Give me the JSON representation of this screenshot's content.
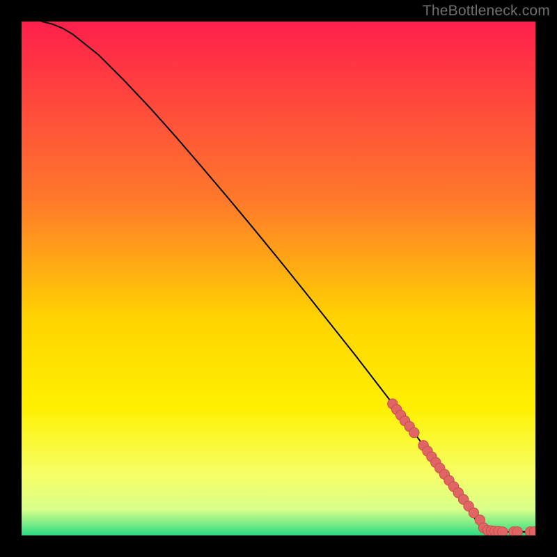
{
  "watermark": "TheBottleneck.com",
  "colors": {
    "black": "#000000",
    "line": "#000000",
    "marker_fill": "#e06666",
    "marker_stroke": "#cc4b4b",
    "gradient_top": "#ff1f4b",
    "gradient_mid1": "#ff7a2a",
    "gradient_mid2": "#ffd400",
    "gradient_mid3": "#fff000",
    "gradient_mid4": "#f7ff66",
    "gradient_mid5": "#d8ff8a",
    "gradient_bottom": "#2bdc82"
  },
  "chart_data": {
    "type": "line",
    "title": "",
    "xlabel": "",
    "ylabel": "",
    "xlim": [
      0,
      100
    ],
    "ylim": [
      0,
      100
    ],
    "grid": false,
    "legend": false,
    "series": [
      {
        "name": "curve",
        "x": [
          4,
          6,
          8,
          10,
          15,
          20,
          25,
          30,
          35,
          40,
          45,
          50,
          55,
          60,
          65,
          70,
          72,
          74,
          76,
          78,
          79,
          80,
          81,
          82,
          83,
          84,
          85,
          86,
          87,
          88,
          89,
          90,
          91,
          92,
          93,
          94,
          95,
          96,
          97,
          98,
          99,
          100
        ],
        "y": [
          100,
          99.5,
          98.7,
          97.5,
          93.5,
          88.5,
          83.2,
          77.6,
          71.8,
          65.9,
          59.9,
          53.8,
          47.6,
          41.3,
          35.0,
          28.5,
          25.9,
          23.2,
          20.5,
          17.8,
          16.4,
          15.0,
          13.6,
          12.2,
          10.8,
          9.4,
          7.9,
          6.5,
          5.0,
          3.6,
          2.1,
          1.2,
          0.9,
          0.8,
          0.8,
          0.7,
          0.7,
          0.7,
          0.7,
          0.7,
          0.7,
          0.7
        ]
      }
    ],
    "markers": {
      "x": [
        72.2,
        73.0,
        73.8,
        74.6,
        75.5,
        76.4,
        78.2,
        79.0,
        79.8,
        80.6,
        81.4,
        82.3,
        83.2,
        84.1,
        85.0,
        86.0,
        87.0,
        88.0,
        89.2,
        89.9,
        90.7,
        91.4,
        92.1,
        92.8,
        93.6,
        95.8,
        96.5,
        99.0,
        99.8
      ],
      "y": [
        25.6,
        24.5,
        23.4,
        22.3,
        21.2,
        20.0,
        17.5,
        16.4,
        15.3,
        14.2,
        13.1,
        11.9,
        10.7,
        9.5,
        8.3,
        7.0,
        5.7,
        4.4,
        3.0,
        1.5,
        1.0,
        0.9,
        0.8,
        0.8,
        0.7,
        0.7,
        0.7,
        0.7,
        0.7
      ]
    }
  }
}
